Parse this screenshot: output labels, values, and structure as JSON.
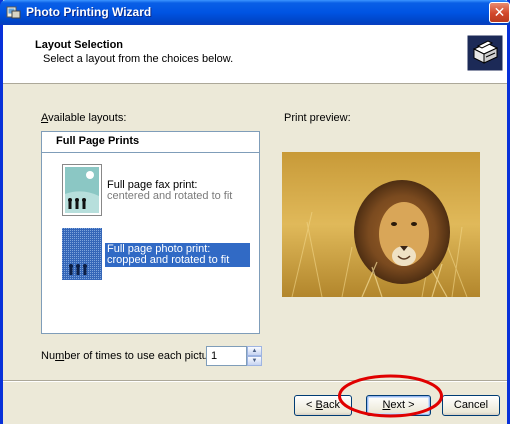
{
  "window": {
    "title": "Photo Printing Wizard",
    "close_glyph": "✕",
    "title_icon": "photo-wizard-icon"
  },
  "header": {
    "title": "Layout Selection",
    "subtitle": "Select a layout from the choices below.",
    "icon": "printer-icon"
  },
  "layouts": {
    "label_mnemonic": "A",
    "label_rest": "vailable layouts:",
    "group_title": "Full Page Prints",
    "items": [
      {
        "title": "Full page fax print:",
        "subtitle": "centered and rotated to fit",
        "selected": false
      },
      {
        "title": "Full page photo print:",
        "subtitle": "cropped and rotated to fit",
        "selected": true
      }
    ]
  },
  "preview": {
    "label": "Print preview:",
    "image": "lion-in-grass-photo"
  },
  "copies": {
    "label_pre": "Nu",
    "label_mnemonic": "m",
    "label_post": "ber of times to use each picture:",
    "value": "1"
  },
  "buttons": {
    "back_pre": "< ",
    "back_mnemonic": "B",
    "back_post": "ack",
    "next_mnemonic": "N",
    "next_post": "ext >",
    "cancel": "Cancel"
  },
  "colors": {
    "titlebar": "#0054e3",
    "selection": "#316ac5",
    "annotation_circle": "#e00000"
  }
}
